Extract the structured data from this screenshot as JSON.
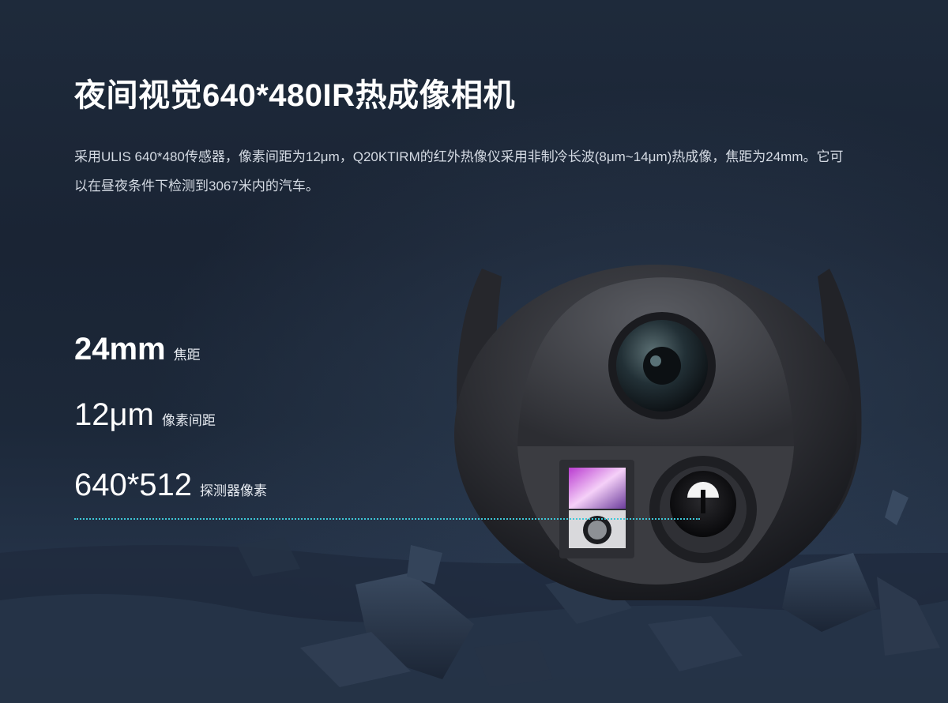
{
  "heading": {
    "title": "夜间视觉640*480IR热成像相机",
    "description": "采用ULIS  640*480传感器，像素间距为12μm，Q20KTIRM的红外热像仪采用非制冷长波(8μm~14μm)热成像，焦距为24mm。它可以在昼夜条件下检测到3067米内的汽车。"
  },
  "specs": [
    {
      "value": "24mm",
      "label": "焦距"
    },
    {
      "value": "12μm",
      "label": "像素间距"
    },
    {
      "value": "640*512",
      "label": "探测器像素"
    }
  ],
  "colors": {
    "background": "#1b2738",
    "accent_line": "#3ec8d8",
    "text_primary": "#ffffff",
    "text_secondary": "#d4dae3"
  },
  "product_image": "thermal-camera-gimbal"
}
